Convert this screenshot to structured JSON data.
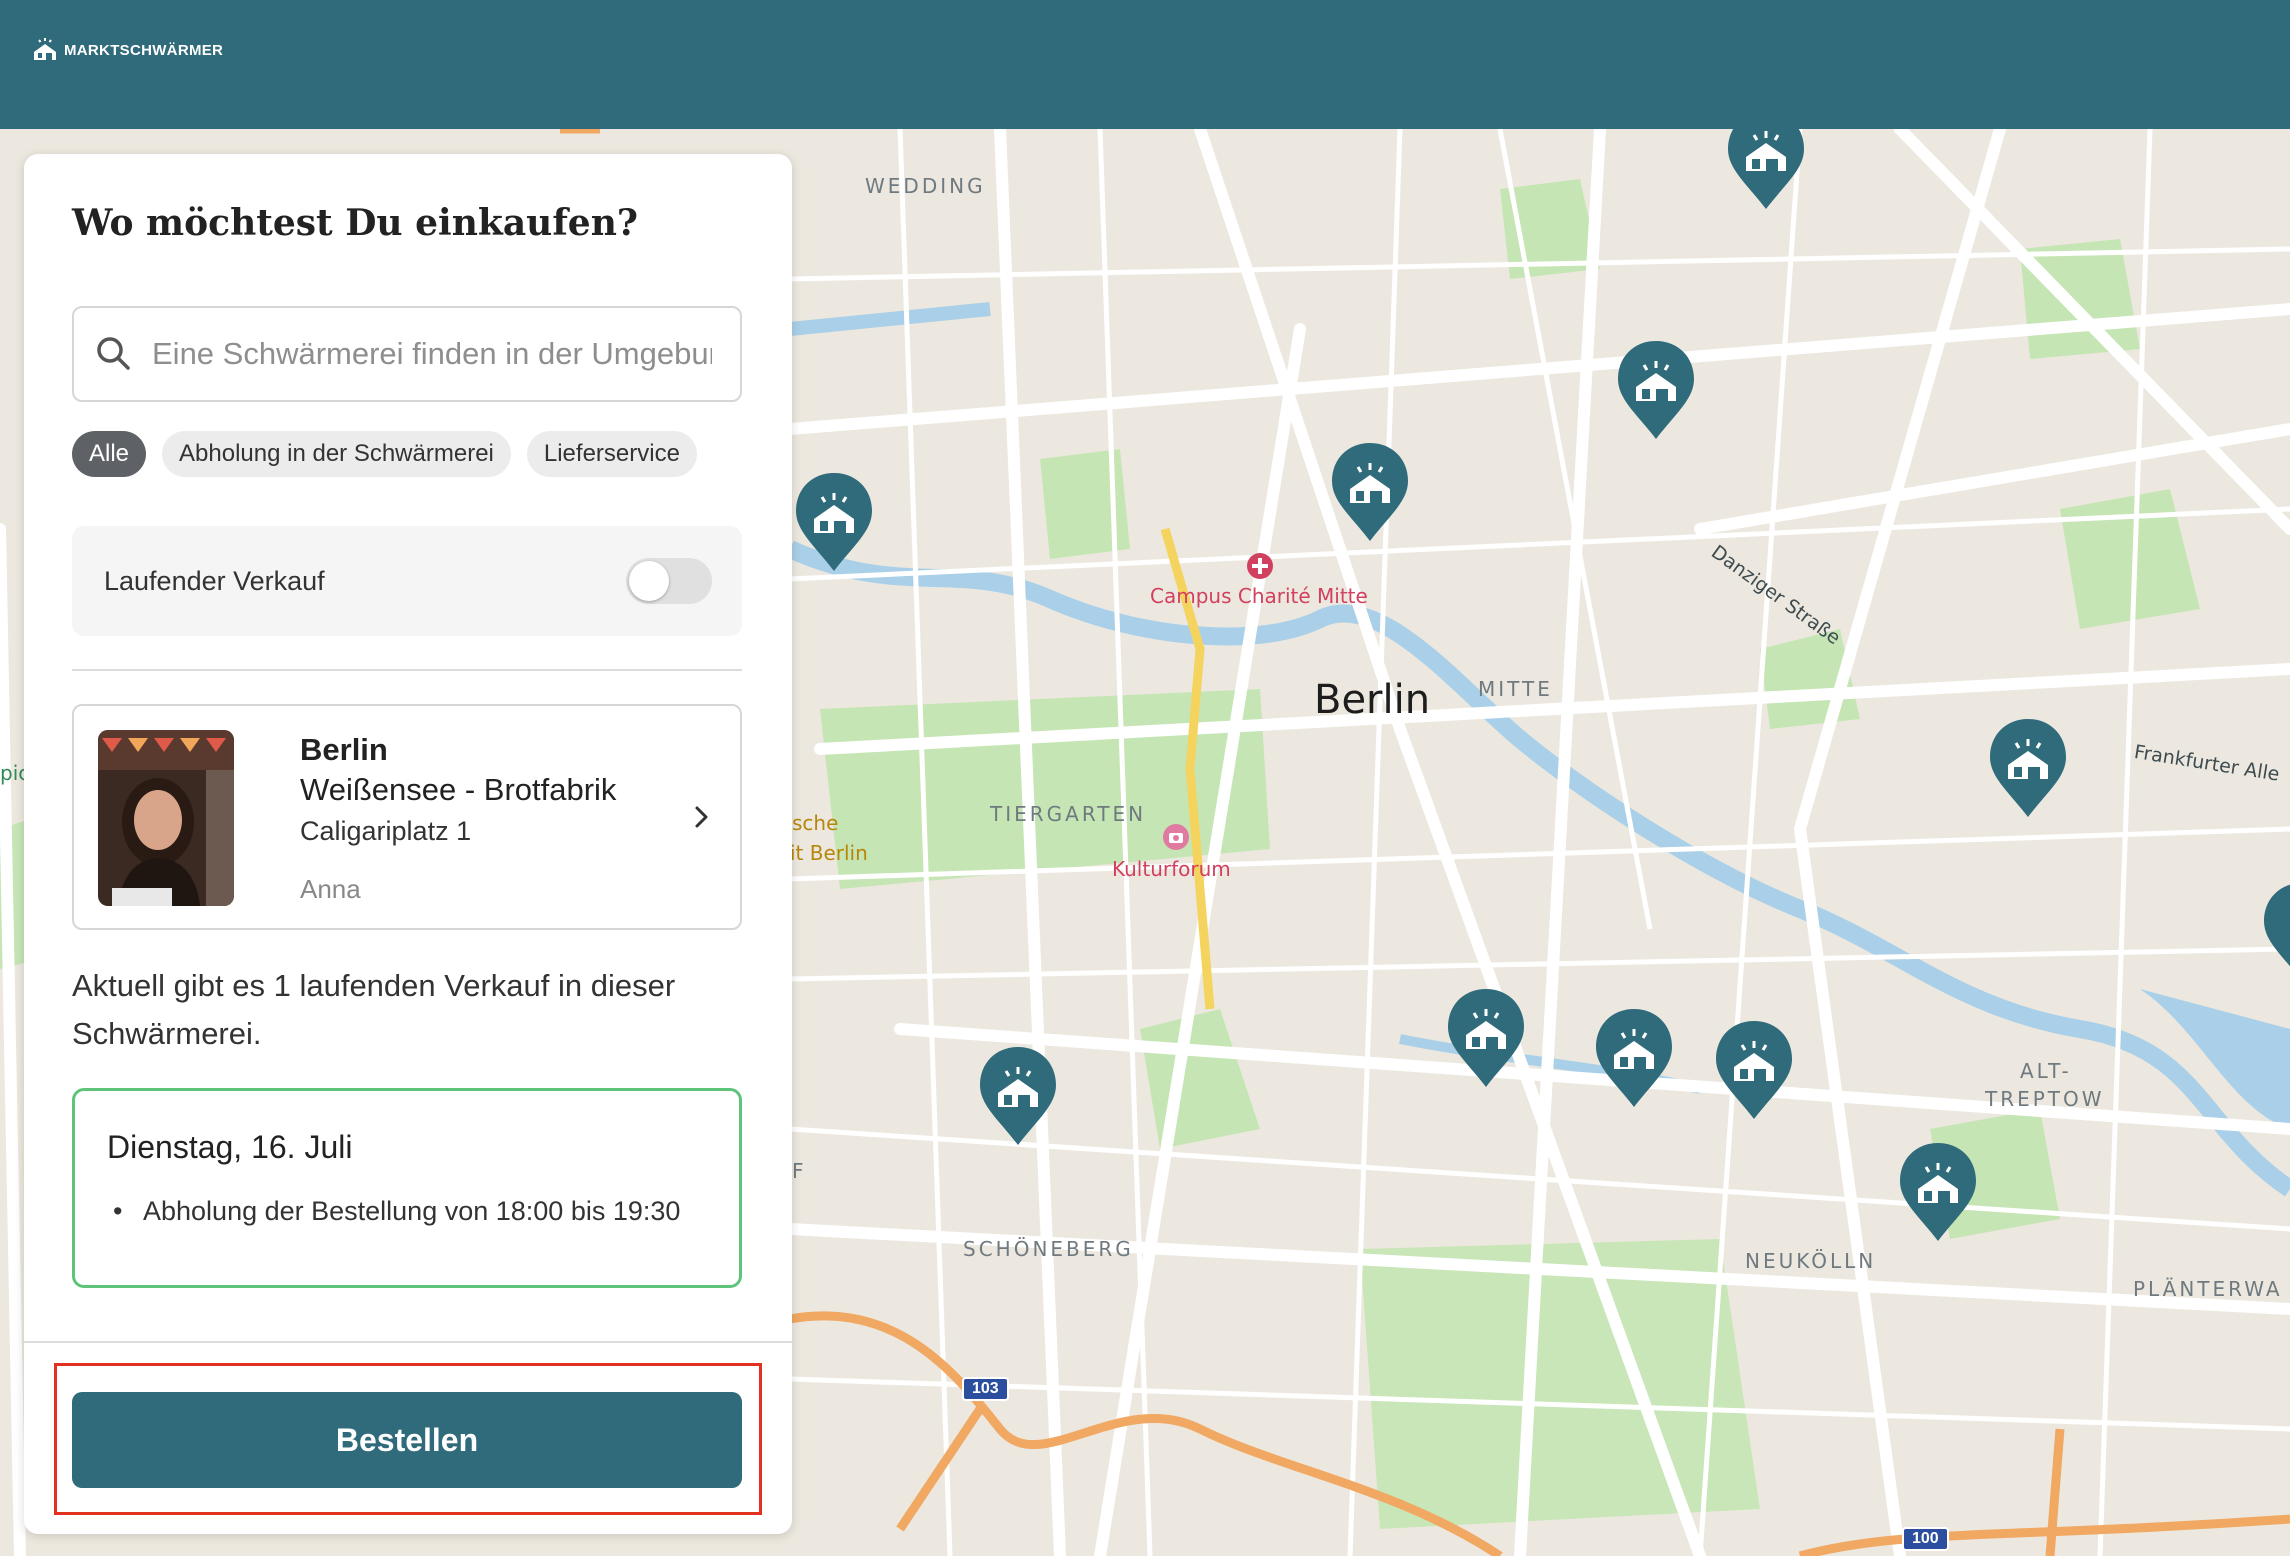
{
  "header": {
    "logo_text": "MARKTSCHWÄRMER",
    "bg_color": "#306b7b"
  },
  "panel": {
    "title": "Wo möchtest Du einkaufen?",
    "search": {
      "placeholder": "Eine Schwärmerei finden in der Umgebung",
      "icon": "search-icon"
    },
    "filters": [
      {
        "label": "Alle",
        "active": true
      },
      {
        "label": "Abholung in der Schwärmerei",
        "active": false
      },
      {
        "label": "Lieferservice",
        "active": false
      }
    ],
    "toggle": {
      "label": "Laufender Verkauf",
      "on": false
    },
    "selected": {
      "city": "Berlin",
      "name": "Weißensee - Brotfabrik",
      "address": "Caligariplatz 1",
      "host": "Anna"
    },
    "info_text": "Aktuell gibt es 1 laufenden Verkauf in dieser Schwärmerei.",
    "sale": {
      "date": "Dienstag, 16. Juli",
      "details": "Abholung der Bestellung von 18:00 bis 19:30"
    },
    "order_button": "Bestellen",
    "accent_color": "#306b7b",
    "sale_border_color": "#5ec47a"
  },
  "map": {
    "city": "Berlin",
    "districts": [
      "WEDDING",
      "MITTE",
      "TIERGARTEN",
      "SCHÖNEBERG",
      "NEUKÖLLN",
      "ALT-",
      "TREPTOW",
      "PLÄNTERWA"
    ],
    "pois": [
      "Campus Charité Mitte",
      "Kulturforum",
      "sche",
      "it Berlin"
    ],
    "streets": [
      "Danziger Straße",
      "Frankfurter Alle"
    ],
    "road_shields": [
      "103",
      "100"
    ],
    "edge_fragments": {
      "left_pic": "pic",
      "left_f": "F"
    }
  }
}
